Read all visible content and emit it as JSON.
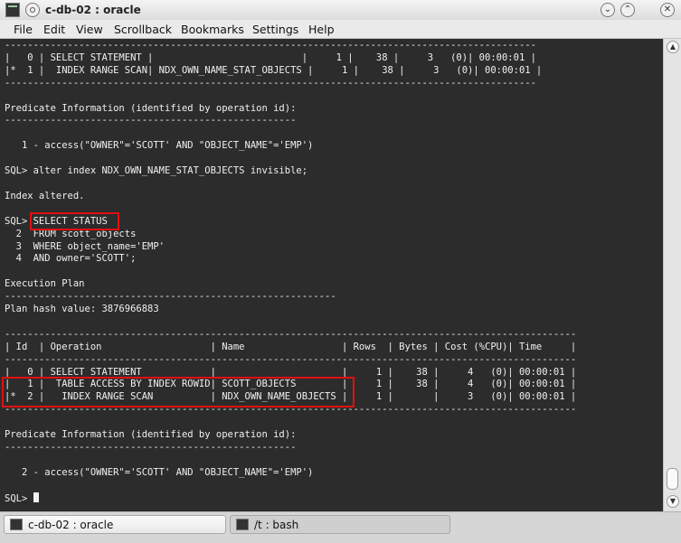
{
  "window": {
    "title": "c-db-02 : oracle",
    "icons": [
      "terminal-icon",
      "window-menu-icon",
      "minimize-icon",
      "maximize-icon",
      "close-icon"
    ]
  },
  "menubar": {
    "items": [
      "File",
      "Edit",
      "View",
      "Scrollback",
      "Bookmarks",
      "Settings",
      "Help"
    ]
  },
  "terminal": {
    "lines": [
      "---------------------------------------------------------------------------------------------",
      "|   0 | SELECT STATEMENT |                          |     1 |    38 |     3   (0)| 00:00:01 |",
      "|*  1 |  INDEX RANGE SCAN| NDX_OWN_NAME_STAT_OBJECTS |     1 |    38 |     3   (0)| 00:00:01 |",
      "---------------------------------------------------------------------------------------------",
      "",
      "Predicate Information (identified by operation id):",
      "---------------------------------------------------",
      "",
      "   1 - access(\"OWNER\"='SCOTT' AND \"OBJECT_NAME\"='EMP')",
      "",
      "SQL> alter index NDX_OWN_NAME_STAT_OBJECTS invisible;",
      "",
      "Index altered.",
      "",
      "SQL> SELECT STATUS",
      "  2  FROM scott_objects",
      "  3  WHERE object_name='EMP'",
      "  4  AND owner='SCOTT';",
      "",
      "Execution Plan",
      "----------------------------------------------------------",
      "Plan hash value: 3876966883",
      "",
      "----------------------------------------------------------------------------------------------------",
      "| Id  | Operation                   | Name                 | Rows  | Bytes | Cost (%CPU)| Time     |",
      "----------------------------------------------------------------------------------------------------",
      "|   0 | SELECT STATEMENT            |                      |     1 |    38 |     4   (0)| 00:00:01 |",
      "|   1 |  TABLE ACCESS BY INDEX ROWID| SCOTT_OBJECTS        |     1 |    38 |     4   (0)| 00:00:01 |",
      "|*  2 |   INDEX RANGE SCAN          | NDX_OWN_NAME_OBJECTS |     1 |       |     3   (0)| 00:00:01 |",
      "----------------------------------------------------------------------------------------------------",
      "",
      "Predicate Information (identified by operation id):",
      "---------------------------------------------------",
      "",
      "   2 - access(\"OWNER\"='SCOTT' AND \"OBJECT_NAME\"='EMP')",
      "",
      "SQL> "
    ],
    "highlight_color": "#e01010"
  },
  "taskbar": {
    "tabs": [
      {
        "label": "c-db-02 : oracle",
        "icon": "terminal-icon"
      },
      {
        "label": "/t : bash",
        "icon": "terminal-icon"
      }
    ]
  }
}
